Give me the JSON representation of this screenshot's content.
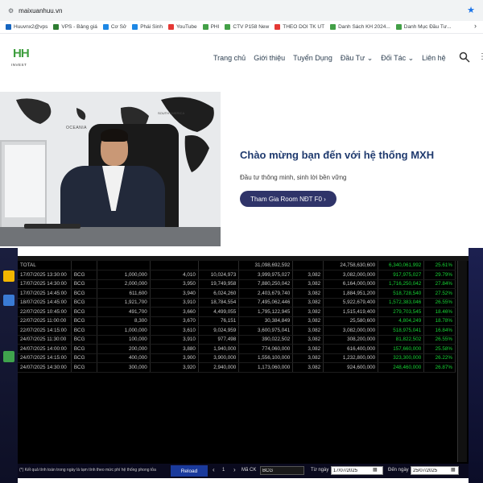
{
  "browser": {
    "url": "maixuanhuu.vn",
    "bookmarks": [
      {
        "label": "Huuvnx2@vps",
        "color": "#1565c0"
      },
      {
        "label": "VPS - Bảng giá",
        "color": "#2e7d32"
      },
      {
        "label": "Cơ Sở",
        "color": "#1e88e5"
      },
      {
        "label": "Phái Sinh",
        "color": "#1e88e5"
      },
      {
        "label": "YouTube",
        "color": "#e53935"
      },
      {
        "label": "PHI",
        "color": "#43a047"
      },
      {
        "label": "CTV P158 New",
        "color": "#43a047"
      },
      {
        "label": "THEO DOI TK UT",
        "color": "#e53935"
      },
      {
        "label": "Danh Sách KH 2024...",
        "color": "#43a047"
      },
      {
        "label": "Danh Mục Đầu Tư...",
        "color": "#43a047"
      }
    ]
  },
  "site": {
    "logo_text": "HH",
    "logo_subtext": "INVEST",
    "menu": [
      "Trang chủ",
      "Giới thiệu",
      "Tuyển Dụng",
      "Đầu Tư ⌄",
      "Đối Tác ⌄",
      "Liên hệ"
    ]
  },
  "hero": {
    "image_labels": [
      "OCEANIA",
      "SOUTH AMERICA"
    ],
    "title": "Chào mừng bạn đến với hệ thống MXH",
    "subtitle": "Đầu tư thông minh, sinh lời bền vững",
    "button": "Tham Gia Room NĐT F0  ›"
  },
  "table": {
    "total": [
      "TOTAL",
      "",
      "",
      "",
      "",
      "31,098,692,592",
      "",
      "24,758,630,600",
      "6,340,061,992",
      "25.61%"
    ],
    "rows": [
      [
        "17/07/2025 13:30:00",
        "BCG",
        "1,000,000",
        "4,010",
        "10,024,973",
        "3,999,975,027",
        "3,082",
        "3,082,000,000",
        "917,975,027",
        "29.79%"
      ],
      [
        "17/07/2025 14:30:00",
        "BCG",
        "2,000,000",
        "3,950",
        "19,749,958",
        "7,880,250,042",
        "3,082",
        "6,164,000,000",
        "1,716,250,042",
        "27.84%"
      ],
      [
        "17/07/2025 14:45:00",
        "BCG",
        "611,600",
        "3,940",
        "6,024,260",
        "2,403,679,740",
        "3,082",
        "1,884,951,200",
        "518,728,540",
        "27.52%"
      ],
      [
        "18/07/2025 14:45:00",
        "BCG",
        "1,921,700",
        "3,910",
        "18,784,554",
        "7,495,062,446",
        "3,082",
        "5,922,679,400",
        "1,572,383,046",
        "26.55%"
      ],
      [
        "22/07/2025 10:45:00",
        "BCG",
        "491,700",
        "3,660",
        "4,499,055",
        "1,795,122,945",
        "3,082",
        "1,515,419,400",
        "279,703,545",
        "18.46%"
      ],
      [
        "22/07/2025 11:00:00",
        "BCG",
        "8,300",
        "3,670",
        "76,151",
        "30,384,849",
        "3,082",
        "25,580,600",
        "4,804,249",
        "18.78%"
      ],
      [
        "22/07/2025 14:15:00",
        "BCG",
        "1,000,000",
        "3,610",
        "9,024,959",
        "3,600,975,041",
        "3,082",
        "3,082,000,000",
        "518,975,041",
        "16.84%"
      ],
      [
        "24/07/2025 11:30:00",
        "BCG",
        "100,000",
        "3,910",
        "977,498",
        "390,022,502",
        "3,082",
        "308,200,000",
        "81,822,502",
        "26.55%"
      ],
      [
        "24/07/2025 14:00:00",
        "BCG",
        "200,000",
        "3,880",
        "1,940,000",
        "774,060,000",
        "3,082",
        "616,400,000",
        "157,660,000",
        "25.58%"
      ],
      [
        "24/07/2025 14:15:00",
        "BCG",
        "400,000",
        "3,900",
        "3,900,000",
        "1,556,100,000",
        "3,082",
        "1,232,800,000",
        "323,300,000",
        "26.22%"
      ],
      [
        "24/07/2025 14:30:00",
        "BCG",
        "300,000",
        "3,920",
        "2,940,000",
        "1,173,060,000",
        "3,082",
        "924,600,000",
        "248,460,000",
        "26.87%"
      ]
    ]
  },
  "controls": {
    "note": "(*) Kết quả tính toán trong ngày là tạm tính theo mức phí hệ thống phong tỏa",
    "reload": "Reload",
    "page": "1",
    "mack_label": "Mã CK",
    "mack_value": "BCG",
    "from_label": "Từ ngày",
    "from_value": "17/07/2025",
    "to_label": "Đến ngày",
    "to_value": "25/07/2025"
  }
}
